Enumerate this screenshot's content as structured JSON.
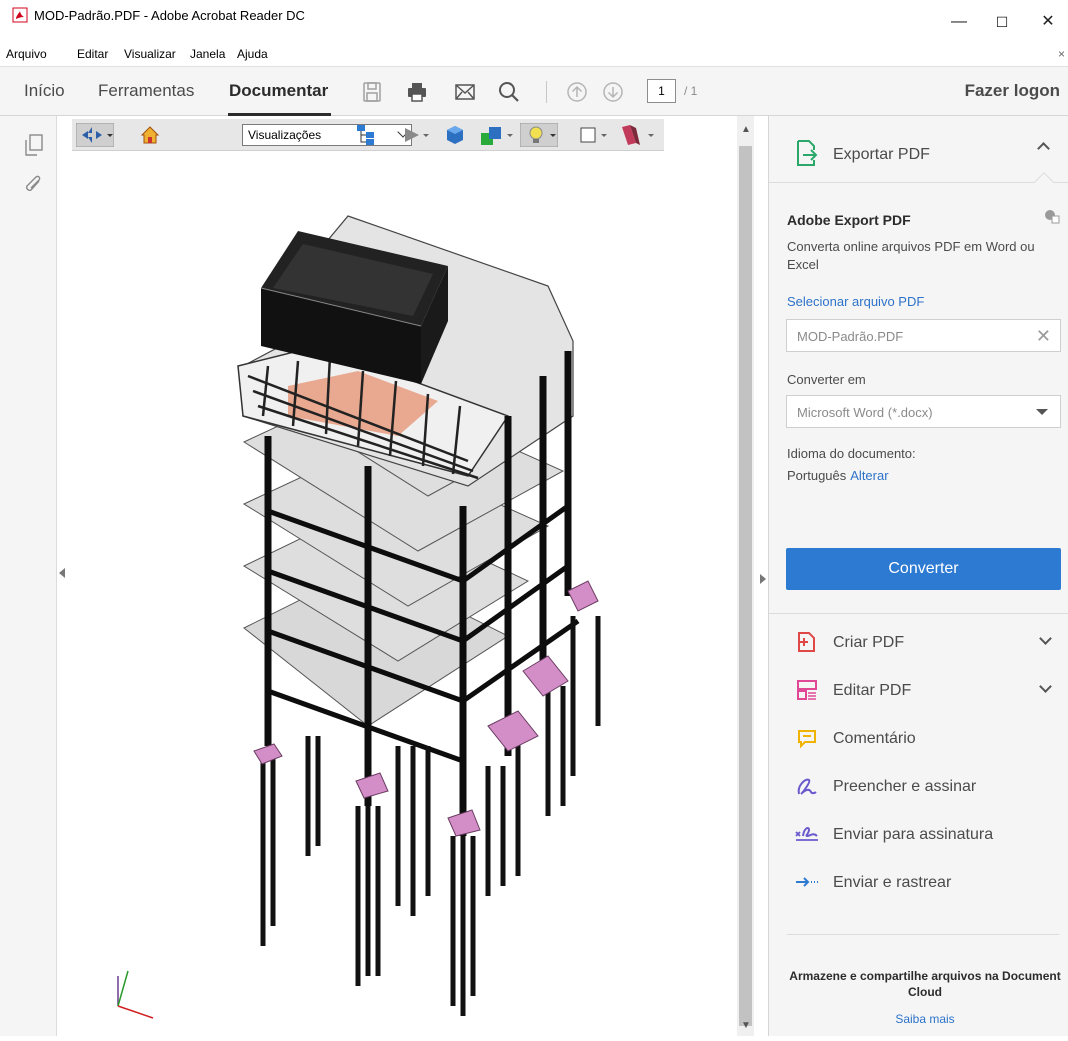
{
  "window": {
    "title": "MOD-Padrão.PDF - Adobe Acrobat Reader DC",
    "minimize": "—",
    "maximize": "☐",
    "close": "✕"
  },
  "menu": {
    "items": [
      "Arquivo",
      "Editar",
      "Visualizar",
      "Janela",
      "Ajuda"
    ],
    "close_doc": "×"
  },
  "toolbar": {
    "tabs": [
      "Início",
      "Ferramentas",
      "Documentar"
    ],
    "active_tab": "Documentar",
    "page_current": "1",
    "page_total": "/ 1",
    "login": "Fazer logon"
  },
  "view3d": {
    "views_label": "Visualizações"
  },
  "right_panel": {
    "header": "Exportar PDF",
    "title": "Adobe Export PDF",
    "description": "Converta online arquivos PDF em Word ou Excel",
    "select_file_link": "Selecionar arquivo PDF",
    "file_value": "MOD-Padrão.PDF",
    "convert_to_label": "Converter em",
    "convert_to_value": "Microsoft Word (*.docx)",
    "language_label": "Idioma do documento:",
    "language_value": "Português",
    "language_change": "Alterar",
    "convert_button": "Converter",
    "tools": [
      {
        "label": "Criar PDF",
        "icon": "create-pdf-icon"
      },
      {
        "label": "Editar PDF",
        "icon": "edit-pdf-icon"
      },
      {
        "label": "Comentário",
        "icon": "comment-icon"
      },
      {
        "label": "Preencher e assinar",
        "icon": "fill-sign-icon"
      },
      {
        "label": "Enviar para assinatura",
        "icon": "send-signature-icon"
      },
      {
        "label": "Enviar e rastrear",
        "icon": "send-track-icon"
      }
    ],
    "cloud_text": "Armazene e compartilhe arquivos na Document Cloud",
    "learn_more": "Saiba mais"
  },
  "colors": {
    "accent": "#2d7ad3",
    "link": "#2d73c9",
    "panel_bg": "#f5f5f5"
  }
}
